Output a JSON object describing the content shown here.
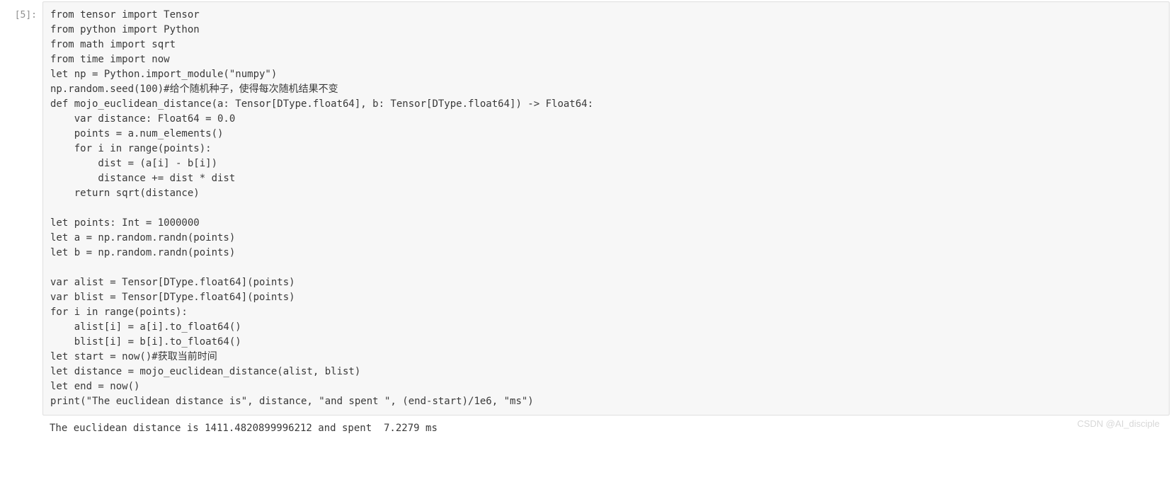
{
  "cell": {
    "prompt": "[5]:",
    "code": "from tensor import Tensor\nfrom python import Python\nfrom math import sqrt\nfrom time import now\nlet np = Python.import_module(\"numpy\")\nnp.random.seed(100)#给个随机种子，使得每次随机结果不变\ndef mojo_euclidean_distance(a: Tensor[DType.float64], b: Tensor[DType.float64]) -> Float64:\n    var distance: Float64 = 0.0\n    points = a.num_elements()\n    for i in range(points):\n        dist = (a[i] - b[i])\n        distance += dist * dist\n    return sqrt(distance)\n\nlet points: Int = 1000000\nlet a = np.random.randn(points)\nlet b = np.random.randn(points)\n\nvar alist = Tensor[DType.float64](points)\nvar blist = Tensor[DType.float64](points)\nfor i in range(points):\n    alist[i] = a[i].to_float64()\n    blist[i] = b[i].to_float64()\nlet start = now()#获取当前时间\nlet distance = mojo_euclidean_distance(alist, blist)\nlet end = now()\nprint(\"The euclidean distance is\", distance, \"and spent \", (end-start)/1e6, \"ms\")"
  },
  "output": {
    "text": "The euclidean distance is 1411.4820899996212 and spent  7.2279 ms"
  },
  "watermark": "CSDN @AI_disciple"
}
